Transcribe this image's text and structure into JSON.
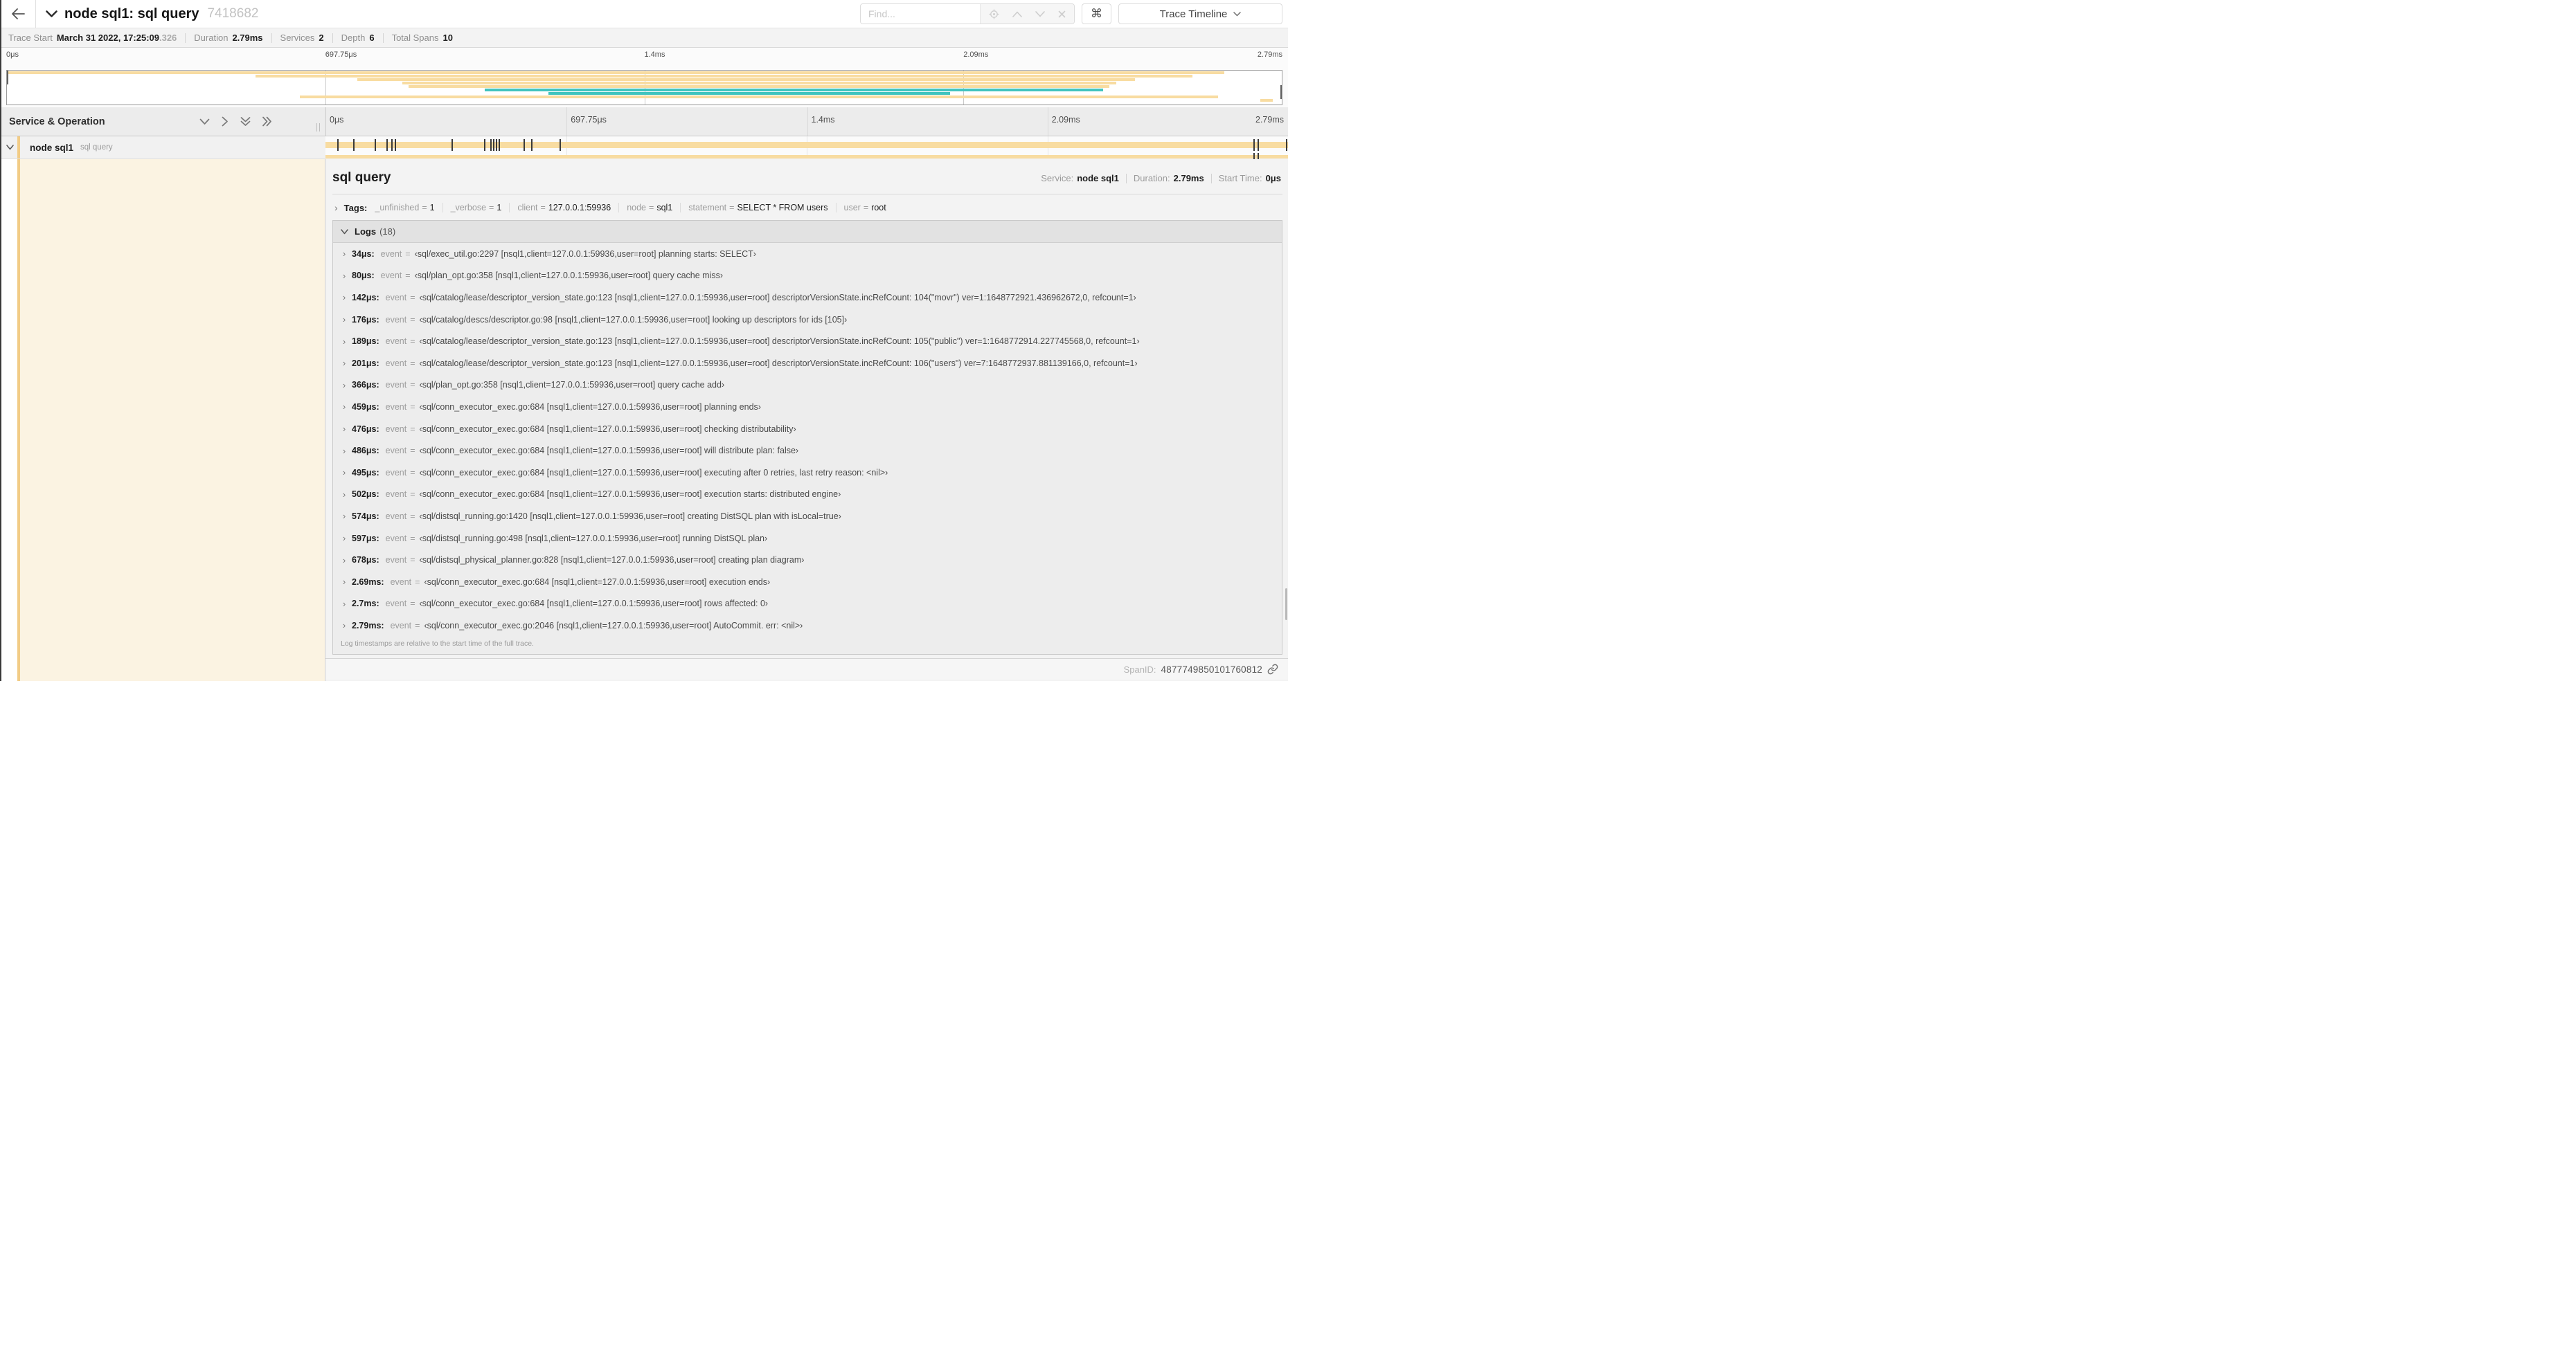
{
  "colors": {
    "tan": "#F8DCA1",
    "teal": "#41C4BF",
    "accent": "#F2CC86",
    "cream": "#FBF3E2"
  },
  "header": {
    "title": "node sql1: sql query",
    "trace_id_short": "7418682",
    "find_placeholder": "Find...",
    "shortcut_glyph": "⌘",
    "view_selector": "Trace Timeline"
  },
  "trace_info": {
    "items": [
      {
        "label": "Trace Start",
        "value": "March 31 2022, 17:25:09",
        "suffix": ".326"
      },
      {
        "label": "Duration",
        "value": "2.79ms"
      },
      {
        "label": "Services",
        "value": "2"
      },
      {
        "label": "Depth",
        "value": "6"
      },
      {
        "label": "Total Spans",
        "value": "10"
      }
    ]
  },
  "minimap": {
    "ticks": [
      "0μs",
      "697.75μs",
      "1.4ms",
      "2.09ms",
      "2.79ms"
    ],
    "tick_pcts": [
      0,
      25,
      50,
      75,
      100
    ],
    "grid_pcts": [
      25,
      50,
      75
    ],
    "spans": [
      {
        "start": 0,
        "end": 95.5,
        "color": "tan"
      },
      {
        "start": 19.5,
        "end": 93,
        "color": "tan"
      },
      {
        "start": 27.5,
        "end": 88.5,
        "color": "tan"
      },
      {
        "start": 31,
        "end": 87,
        "color": "tan"
      },
      {
        "start": 31.5,
        "end": 86.5,
        "color": "tan"
      },
      {
        "start": 37.5,
        "end": 86,
        "color": "teal"
      },
      {
        "start": 42.5,
        "end": 74,
        "color": "teal"
      },
      {
        "start": 23,
        "end": 95,
        "color": "tan"
      },
      {
        "start": 98.3,
        "end": 99.3,
        "color": "tan"
      }
    ]
  },
  "timeline": {
    "col_header": "Service & Operation",
    "ticks": [
      "0μs",
      "697.75μs",
      "1.4ms",
      "2.09ms",
      "2.79ms"
    ],
    "tick_pcts": [
      0,
      25,
      50,
      75,
      100
    ],
    "grid_pcts": [
      25,
      50,
      75
    ],
    "row": {
      "service": "node sql1",
      "operation": "sql query"
    },
    "bar": {
      "start": 0,
      "end": 100,
      "color": "tan"
    },
    "log_marker_pcts": [
      1.2,
      2.9,
      5.1,
      6.3,
      6.8,
      7.2,
      13.1,
      16.5,
      17.1,
      17.4,
      17.7,
      18.0,
      20.6,
      21.4,
      24.3,
      96.4,
      96.8,
      99.8
    ],
    "strip_marker_pcts": [
      96.4,
      96.8
    ]
  },
  "detail": {
    "title": "sql query",
    "overview": [
      {
        "label": "Service:",
        "value": "node sql1"
      },
      {
        "label": "Duration:",
        "value": "2.79ms"
      },
      {
        "label": "Start Time:",
        "value": "0μs"
      }
    ],
    "tags": {
      "label": "Tags:",
      "items": [
        {
          "key": "_unfinished",
          "value": "1"
        },
        {
          "key": "_verbose",
          "value": "1"
        },
        {
          "key": "client",
          "value": "127.0.0.1:59936"
        },
        {
          "key": "node",
          "value": "sql1"
        },
        {
          "key": "statement",
          "value": "SELECT * FROM users"
        },
        {
          "key": "user",
          "value": "root"
        }
      ]
    },
    "logs": {
      "label": "Logs",
      "count": "(18)",
      "field": "event",
      "entries": [
        {
          "t": "34μs:",
          "msg": "‹sql/exec_util.go:2297 [nsql1,client=127.0.0.1:59936,user=root] planning starts: SELECT›"
        },
        {
          "t": "80μs:",
          "msg": "‹sql/plan_opt.go:358 [nsql1,client=127.0.0.1:59936,user=root] query cache miss›"
        },
        {
          "t": "142μs:",
          "msg": "‹sql/catalog/lease/descriptor_version_state.go:123 [nsql1,client=127.0.0.1:59936,user=root] descriptorVersionState.incRefCount: 104(\"movr\") ver=1:1648772921.436962672,0, refcount=1›"
        },
        {
          "t": "176μs:",
          "msg": "‹sql/catalog/descs/descriptor.go:98 [nsql1,client=127.0.0.1:59936,user=root] looking up descriptors for ids [105]›"
        },
        {
          "t": "189μs:",
          "msg": "‹sql/catalog/lease/descriptor_version_state.go:123 [nsql1,client=127.0.0.1:59936,user=root] descriptorVersionState.incRefCount: 105(\"public\") ver=1:1648772914.227745568,0, refcount=1›"
        },
        {
          "t": "201μs:",
          "msg": "‹sql/catalog/lease/descriptor_version_state.go:123 [nsql1,client=127.0.0.1:59936,user=root] descriptorVersionState.incRefCount: 106(\"users\") ver=7:1648772937.881139166,0, refcount=1›"
        },
        {
          "t": "366μs:",
          "msg": "‹sql/plan_opt.go:358 [nsql1,client=127.0.0.1:59936,user=root] query cache add›"
        },
        {
          "t": "459μs:",
          "msg": "‹sql/conn_executor_exec.go:684 [nsql1,client=127.0.0.1:59936,user=root] planning ends›"
        },
        {
          "t": "476μs:",
          "msg": "‹sql/conn_executor_exec.go:684 [nsql1,client=127.0.0.1:59936,user=root] checking distributability›"
        },
        {
          "t": "486μs:",
          "msg": "‹sql/conn_executor_exec.go:684 [nsql1,client=127.0.0.1:59936,user=root] will distribute plan: false›"
        },
        {
          "t": "495μs:",
          "msg": "‹sql/conn_executor_exec.go:684 [nsql1,client=127.0.0.1:59936,user=root] executing after 0 retries, last retry reason: <nil>›"
        },
        {
          "t": "502μs:",
          "msg": "‹sql/conn_executor_exec.go:684 [nsql1,client=127.0.0.1:59936,user=root] execution starts: distributed engine›"
        },
        {
          "t": "574μs:",
          "msg": "‹sql/distsql_running.go:1420 [nsql1,client=127.0.0.1:59936,user=root] creating DistSQL plan with isLocal=true›"
        },
        {
          "t": "597μs:",
          "msg": "‹sql/distsql_running.go:498 [nsql1,client=127.0.0.1:59936,user=root] running DistSQL plan›"
        },
        {
          "t": "678μs:",
          "msg": "‹sql/distsql_physical_planner.go:828 [nsql1,client=127.0.0.1:59936,user=root] creating plan diagram›"
        },
        {
          "t": "2.69ms:",
          "msg": "‹sql/conn_executor_exec.go:684 [nsql1,client=127.0.0.1:59936,user=root] execution ends›"
        },
        {
          "t": "2.7ms:",
          "msg": "‹sql/conn_executor_exec.go:684 [nsql1,client=127.0.0.1:59936,user=root] rows affected: 0›"
        },
        {
          "t": "2.79ms:",
          "msg": "‹sql/conn_executor_exec.go:2046 [nsql1,client=127.0.0.1:59936,user=root] AutoCommit. err: <nil>›"
        }
      ],
      "footnote": "Log timestamps are relative to the start time of the full trace."
    },
    "span_id_label": "SpanID:",
    "span_id": "4877749850101760812"
  }
}
